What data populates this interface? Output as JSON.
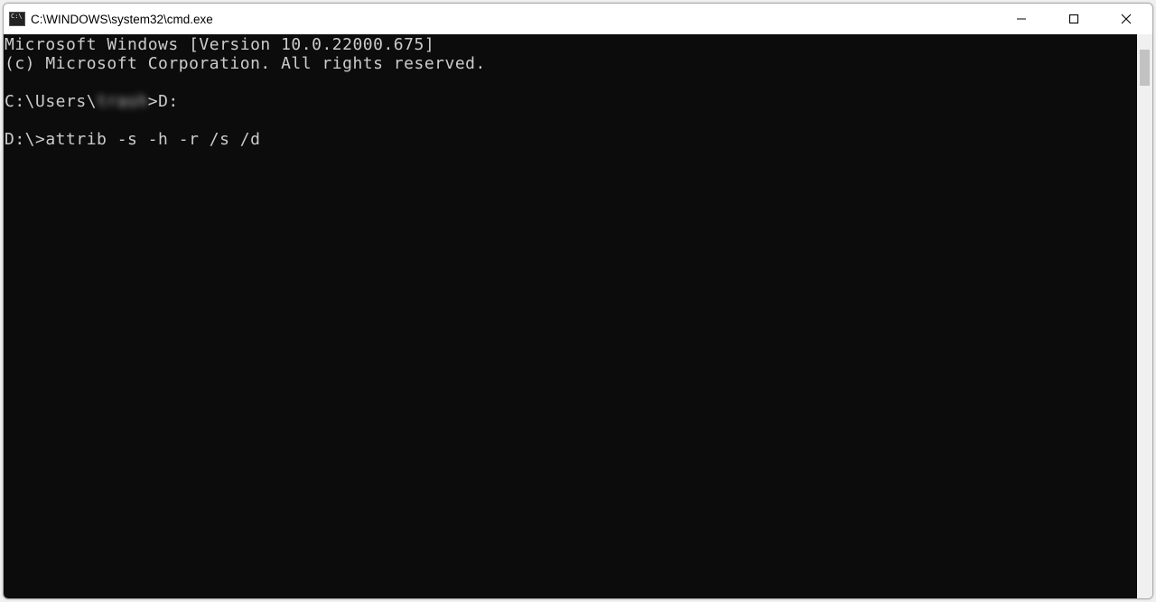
{
  "window": {
    "title": "C:\\WINDOWS\\system32\\cmd.exe"
  },
  "terminal": {
    "line1": "Microsoft Windows [Version 10.0.22000.675]",
    "line2": "(c) Microsoft Corporation. All rights reserved.",
    "blank1": "",
    "prompt1_prefix": "C:\\Users\\",
    "prompt1_user": "trash",
    "prompt1_suffix": ">D:",
    "blank2": "",
    "prompt2": "D:\\>attrib -s -h -r /s /d"
  }
}
